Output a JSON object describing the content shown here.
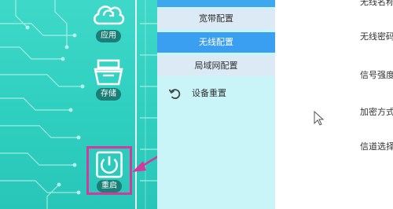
{
  "sidebar": {
    "items": [
      {
        "label": "应用",
        "icon": "cloud-refresh-icon"
      },
      {
        "label": "存储",
        "icon": "storage-basket-icon"
      },
      {
        "label": "重启",
        "icon": "power-icon"
      }
    ]
  },
  "menu": {
    "items": [
      {
        "label": "宽带配置"
      },
      {
        "label": "无线配置",
        "selected": true
      },
      {
        "label": "局域网配置"
      },
      {
        "label": "设备重置",
        "icon": "reset-icon"
      }
    ]
  },
  "content": {
    "field_labels": [
      "无线名称",
      "无线密码",
      "信号强度",
      "加密方式",
      "信道选择"
    ]
  },
  "colors": {
    "sidebar_teal": "#2fcfc0",
    "menu_bg": "#c9f4f8",
    "active_blue": "#3a9ff0",
    "annotation_magenta": "#d23a9e"
  }
}
